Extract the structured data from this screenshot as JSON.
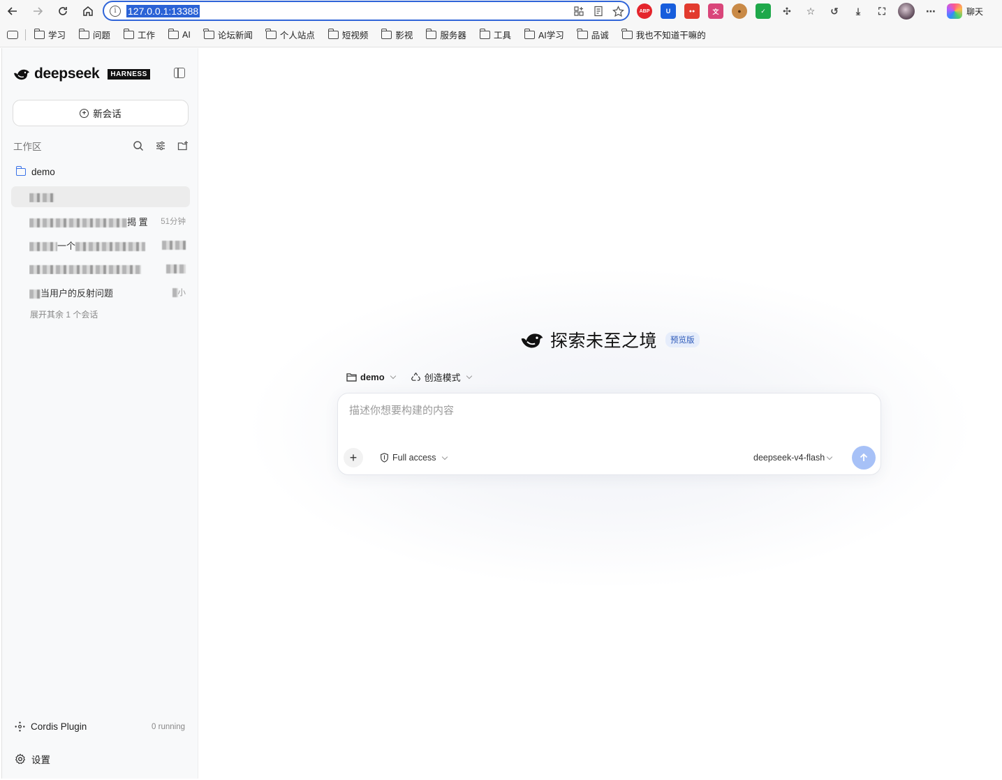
{
  "browser": {
    "url": "127.0.0.1:13388",
    "chat_label": "聊天",
    "extensions": [
      {
        "name": "abp",
        "label": "ABP",
        "color": "#e4252c"
      },
      {
        "name": "bitwarden",
        "label": "U",
        "color": "#175ddc"
      },
      {
        "name": "red-ext",
        "label": "●●",
        "color": "#e23b2e"
      },
      {
        "name": "translate",
        "label": "文",
        "color": "#d9467a"
      },
      {
        "name": "cookie",
        "label": "●",
        "color": "#a86a2d"
      },
      {
        "name": "check-ext",
        "label": "✓",
        "color": "#1ea84a"
      }
    ]
  },
  "bookmarks": [
    "学习",
    "问题",
    "工作",
    "AI",
    "论坛新闻",
    "个人站点",
    "短视频",
    "影视",
    "服务器",
    "工具",
    "AI学习",
    "品诚",
    "我也不知道干嘛的"
  ],
  "sidebar": {
    "brand": "deepseek",
    "brand_badge": "HARNESS",
    "new_chat": "新会话",
    "workspace_title": "工作区",
    "folder": "demo",
    "conversations": [
      {
        "title": "",
        "time": ""
      },
      {
        "title": "揭 置",
        "time": "51分钟"
      },
      {
        "title": "一个",
        "time": ""
      },
      {
        "title": "",
        "time": ""
      },
      {
        "title": "当用户的反射问题",
        "time": "小"
      }
    ],
    "expand_more": "展开其余 1 个会话",
    "plugin_label": "Cordis Plugin",
    "plugin_status": "0 running",
    "settings": "设置"
  },
  "main": {
    "hero_title": "探索未至之境",
    "hero_badge": "预览版",
    "workspace_select": "demo",
    "mode_select": "创造模式",
    "prompt_placeholder": "描述你想要构建的内容",
    "access_label": "Full access",
    "model_label": "deepseek-v4-flash"
  },
  "colors": {
    "accent": "#2f64d8",
    "send_button": "#a7c1f7",
    "badge_bg": "#e6edfb",
    "folder_icon": "#3a72e8"
  }
}
